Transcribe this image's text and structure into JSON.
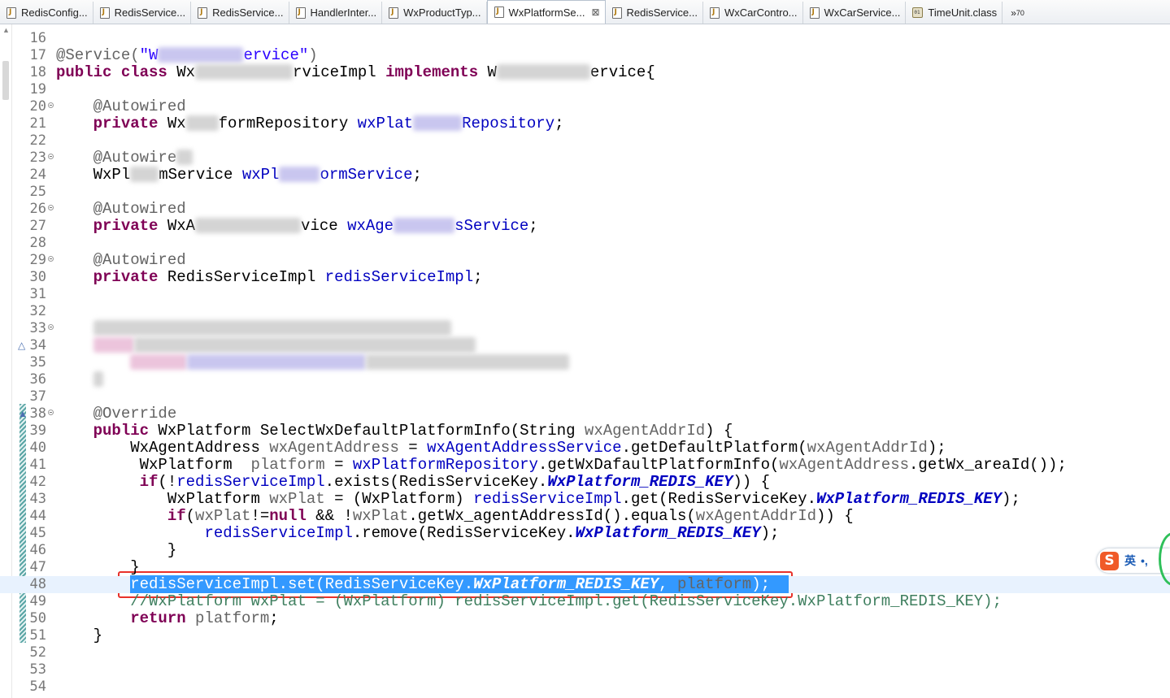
{
  "tabs": [
    {
      "label": "RedisConfig...",
      "kind": "java",
      "active": false
    },
    {
      "label": "RedisService...",
      "kind": "java",
      "active": false
    },
    {
      "label": "RedisService...",
      "kind": "java",
      "active": false
    },
    {
      "label": "HandlerInter...",
      "kind": "java",
      "active": false
    },
    {
      "label": "WxProductTyp...",
      "kind": "java",
      "active": false
    },
    {
      "label": "WxPlatformSe...",
      "kind": "java",
      "active": true,
      "close": "⊠"
    },
    {
      "label": "RedisService...",
      "kind": "java",
      "active": false
    },
    {
      "label": "WxCarContro...",
      "kind": "java",
      "active": false
    },
    {
      "label": "WxCarService...",
      "kind": "java",
      "active": false
    },
    {
      "label": "TimeUnit.class",
      "kind": "class",
      "active": false
    }
  ],
  "tab_overflow": {
    "glyph": "»",
    "count": "70"
  },
  "lines": [
    {
      "n": "16",
      "t": []
    },
    {
      "n": "17",
      "t": [
        [
          "an",
          "@Service("
        ],
        [
          "st",
          "\"W"
        ],
        [
          "blur",
          "pu",
          105
        ],
        [
          "st",
          "ervice\""
        ],
        [
          "an",
          ")"
        ]
      ]
    },
    {
      "n": "18",
      "t": [
        [
          "kw",
          "public class "
        ],
        [
          "",
          "Wx"
        ],
        [
          "blur",
          "gy",
          120
        ],
        [
          "",
          "rviceImpl "
        ],
        [
          "kw",
          "implements "
        ],
        [
          "",
          "W"
        ],
        [
          "blur",
          "gy",
          115
        ],
        [
          "",
          "ervice{"
        ]
      ]
    },
    {
      "n": "19",
      "t": []
    },
    {
      "n": "20",
      "fold": true,
      "t": [
        [
          "an",
          "    @Autowired"
        ]
      ]
    },
    {
      "n": "21",
      "t": [
        [
          "kw",
          "    private "
        ],
        [
          "",
          "Wx"
        ],
        [
          "blur",
          "gy",
          40
        ],
        [
          "",
          "formRepository "
        ],
        [
          "fd",
          "wxPlat"
        ],
        [
          "blur",
          "pu",
          60
        ],
        [
          "fd",
          "Repository"
        ],
        [
          "",
          ";"
        ]
      ]
    },
    {
      "n": "22",
      "t": []
    },
    {
      "n": "23",
      "fold": true,
      "t": [
        [
          "an",
          "    @Autowire"
        ],
        [
          "blur",
          "gy",
          20
        ]
      ]
    },
    {
      "n": "24",
      "t": [
        [
          "",
          "    WxPl"
        ],
        [
          "blur",
          "gy",
          35
        ],
        [
          "",
          "mService "
        ],
        [
          "fd",
          "wxPl"
        ],
        [
          "blur",
          "pu",
          50
        ],
        [
          "fd",
          "ormService"
        ],
        [
          "",
          ";"
        ]
      ]
    },
    {
      "n": "25",
      "t": []
    },
    {
      "n": "26",
      "fold": true,
      "t": [
        [
          "an",
          "    @Autowired"
        ]
      ]
    },
    {
      "n": "27",
      "t": [
        [
          "kw",
          "    private "
        ],
        [
          "",
          "WxA"
        ],
        [
          "blur",
          "gy",
          130
        ],
        [
          "",
          "vice "
        ],
        [
          "fd",
          "wxAge"
        ],
        [
          "blur",
          "pu",
          75
        ],
        [
          "fd",
          "sService"
        ],
        [
          "",
          ";"
        ]
      ]
    },
    {
      "n": "28",
      "t": []
    },
    {
      "n": "29",
      "fold": true,
      "t": [
        [
          "an",
          "    @Autowired"
        ]
      ]
    },
    {
      "n": "30",
      "t": [
        [
          "kw",
          "    private "
        ],
        [
          "",
          "RedisServiceImpl "
        ],
        [
          "fd",
          "redisServiceImpl"
        ],
        [
          "",
          ";"
        ]
      ]
    },
    {
      "n": "31",
      "t": []
    },
    {
      "n": "32",
      "t": []
    },
    {
      "n": "33",
      "fold": true,
      "t": [
        [
          "",
          "    "
        ],
        [
          "blur",
          "gy",
          440
        ]
      ]
    },
    {
      "n": "34",
      "mark": "△",
      "t": [
        [
          "",
          "    "
        ],
        [
          "blur",
          "pk",
          50
        ],
        [
          "blur",
          "gy",
          420
        ]
      ]
    },
    {
      "n": "35",
      "t": [
        [
          "",
          "        "
        ],
        [
          "blur",
          "pk",
          70
        ],
        [
          "blur",
          "pu",
          220
        ],
        [
          "blur",
          "gy",
          250
        ]
      ]
    },
    {
      "n": "36",
      "t": [
        [
          "",
          "    "
        ],
        [
          "blur",
          "gy",
          12
        ]
      ]
    },
    {
      "n": "37",
      "t": []
    },
    {
      "n": "38",
      "fold": true,
      "mark": "▲",
      "t": [
        [
          "an",
          "    @Override"
        ]
      ]
    },
    {
      "n": "39",
      "t": [
        [
          "kw",
          "    public "
        ],
        [
          "",
          "WxPlatform SelectWxDefaultPlatformInfo(String "
        ],
        [
          "an",
          "wxAgentAddrId"
        ],
        [
          "",
          ") {"
        ]
      ]
    },
    {
      "n": "40",
      "t": [
        [
          "",
          "        WxAgentAddress "
        ],
        [
          "an",
          "wxAgentAddress"
        ],
        [
          "",
          " = "
        ],
        [
          "fd",
          "wxAgentAddressService"
        ],
        [
          "",
          ".getDefaultPlatform("
        ],
        [
          "an",
          "wxAgentAddrId"
        ],
        [
          "",
          ");"
        ]
      ]
    },
    {
      "n": "41",
      "t": [
        [
          "",
          "         WxPlatform  "
        ],
        [
          "an",
          "platform"
        ],
        [
          "",
          " = "
        ],
        [
          "fd",
          "wxPlatformRepository"
        ],
        [
          "",
          ".getWxDafaultPlatformInfo("
        ],
        [
          "an",
          "wxAgentAddress"
        ],
        [
          "",
          ".getWx_areaId());"
        ]
      ]
    },
    {
      "n": "42",
      "t": [
        [
          "kw",
          "         if"
        ],
        [
          "",
          "(!"
        ],
        [
          "fd",
          "redisServiceImpl"
        ],
        [
          "",
          ".exists(RedisServiceKey."
        ],
        [
          "cst",
          "WxPlatform_REDIS_KEY"
        ],
        [
          "",
          ")) {"
        ]
      ]
    },
    {
      "n": "43",
      "t": [
        [
          "",
          "            WxPlatform "
        ],
        [
          "an",
          "wxPlat"
        ],
        [
          "",
          " = (WxPlatform) "
        ],
        [
          "fd",
          "redisServiceImpl"
        ],
        [
          "",
          ".get(RedisServiceKey."
        ],
        [
          "cst",
          "WxPlatform_REDIS_KEY"
        ],
        [
          "",
          ");"
        ]
      ]
    },
    {
      "n": "44",
      "t": [
        [
          "kw",
          "            if"
        ],
        [
          "",
          "("
        ],
        [
          "an",
          "wxPlat"
        ],
        [
          "",
          "!="
        ],
        [
          "kw",
          "null"
        ],
        [
          "",
          " && !"
        ],
        [
          "an",
          "wxPlat"
        ],
        [
          "",
          ".getWx_agentAddressId().equals("
        ],
        [
          "an",
          "wxAgentAddrId"
        ],
        [
          "",
          ")) {"
        ]
      ]
    },
    {
      "n": "45",
      "t": [
        [
          "",
          "                "
        ],
        [
          "fd",
          "redisServiceImpl"
        ],
        [
          "",
          ".remove(RedisServiceKey."
        ],
        [
          "cst",
          "WxPlatform_REDIS_KEY"
        ],
        [
          "",
          ");"
        ]
      ]
    },
    {
      "n": "46",
      "t": [
        [
          "",
          "            }"
        ]
      ]
    },
    {
      "n": "47",
      "t": [
        [
          "",
          "        }"
        ]
      ]
    },
    {
      "n": "48",
      "current": true,
      "selected_from": 1,
      "t": [
        [
          "",
          "        "
        ],
        [
          "fd",
          "redisServiceImpl"
        ],
        [
          "",
          ".set(RedisServiceKey."
        ],
        [
          "cst",
          "WxPlatform_REDIS_KEY"
        ],
        [
          "",
          ", "
        ],
        [
          "an",
          "platform"
        ],
        [
          "",
          ");  "
        ]
      ]
    },
    {
      "n": "49",
      "t": [
        [
          "cm",
          "        //WxPlatform wxPlat = (WxPlatform) redisServiceImpl.get(RedisServiceKey.WxPlatform_REDIS_KEY);"
        ]
      ]
    },
    {
      "n": "50",
      "t": [
        [
          "kw",
          "        return "
        ],
        [
          "an",
          "platform"
        ],
        [
          "",
          ";"
        ]
      ]
    },
    {
      "n": "51",
      "t": [
        [
          "",
          "    }"
        ]
      ]
    },
    {
      "n": "52",
      "t": []
    },
    {
      "n": "53",
      "t": []
    },
    {
      "n": "54",
      "t": []
    }
  ],
  "ime": {
    "logo": "S",
    "mode": "英",
    "punct": "•,"
  },
  "colors": {
    "keyword": "#7f0055",
    "field": "#0000c0",
    "string": "#2a00ff",
    "comment": "#3f7f5f",
    "selection": "#3399ff",
    "highlight_box": "#e8312a"
  }
}
